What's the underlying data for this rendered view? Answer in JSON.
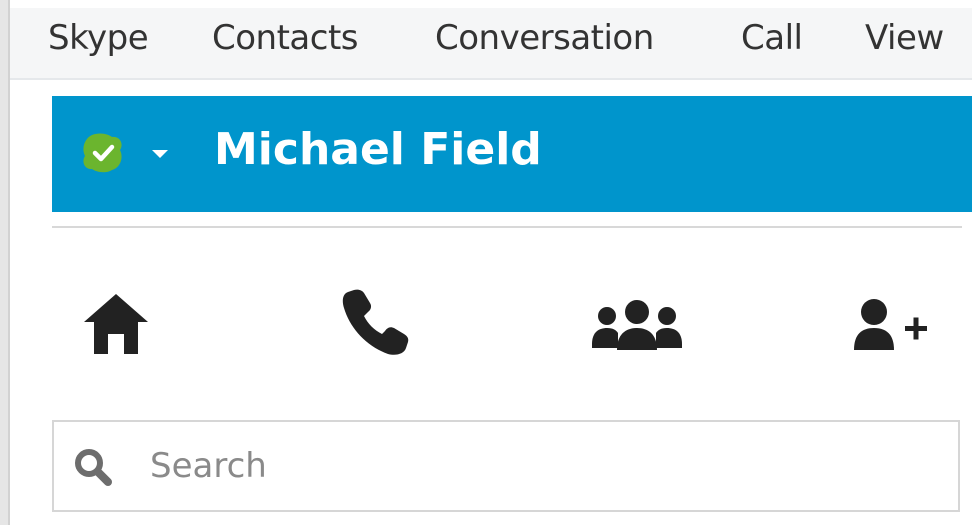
{
  "menu": {
    "items": [
      {
        "label": "Skype"
      },
      {
        "label": "Contacts"
      },
      {
        "label": "Conversation"
      },
      {
        "label": "Call"
      },
      {
        "label": "View"
      }
    ]
  },
  "profile": {
    "name": "Michael Field",
    "status": "online",
    "status_color": "#6bb52e",
    "header_color": "#0095cc"
  },
  "nav": {
    "icons": [
      {
        "name": "home-icon"
      },
      {
        "name": "phone-icon"
      },
      {
        "name": "group-icon"
      },
      {
        "name": "add-contact-icon"
      }
    ]
  },
  "search": {
    "placeholder": "Search",
    "value": ""
  }
}
